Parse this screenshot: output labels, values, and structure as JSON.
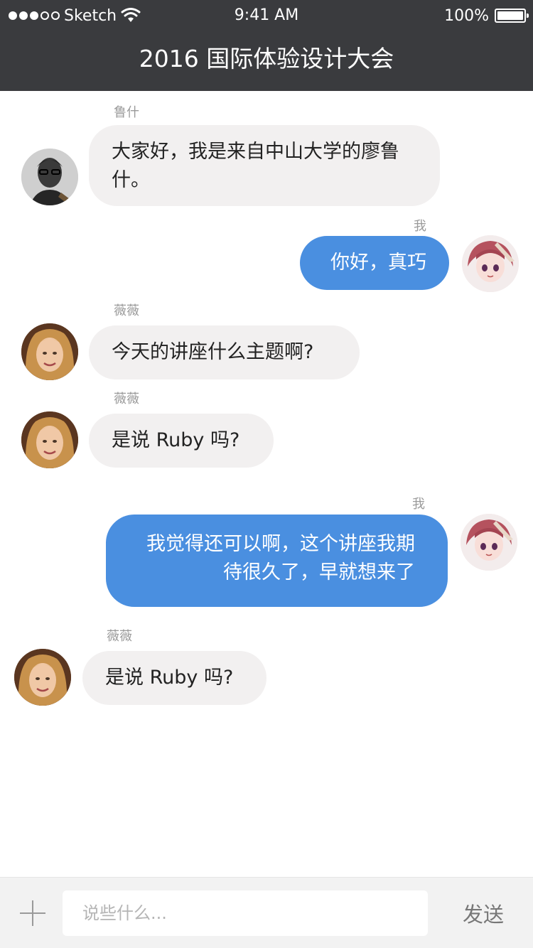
{
  "status_bar": {
    "carrier": "Sketch",
    "time": "9:41 AM",
    "battery": "100%"
  },
  "nav": {
    "title": "2016 国际体验设计大会"
  },
  "messages": [
    {
      "sender": "鲁什",
      "text": "大家好，我是来自中山大学的廖鲁什。",
      "direction": "incoming",
      "avatar": "avatar-man-icon"
    },
    {
      "sender": "我",
      "text": "你好，真巧",
      "direction": "outgoing",
      "avatar": "avatar-anime-girl-icon"
    },
    {
      "sender": "薇薇",
      "text": "今天的讲座什么主题啊?",
      "direction": "incoming",
      "avatar": "avatar-woman-icon"
    },
    {
      "sender": "薇薇",
      "text": "是说 Ruby 吗?",
      "direction": "incoming",
      "avatar": "avatar-woman-icon"
    },
    {
      "sender": "我",
      "text": "我觉得还可以啊，这个讲座我期待很久了，早就想来了",
      "direction": "outgoing",
      "avatar": "avatar-anime-girl-icon"
    },
    {
      "sender": "薇薇",
      "text": "是说 Ruby 吗?",
      "direction": "incoming",
      "avatar": "avatar-woman-icon"
    }
  ],
  "input": {
    "placeholder": "说些什么...",
    "send_label": "发送"
  },
  "colors": {
    "nav_bg": "#3a3b3e",
    "incoming_bubble": "#f2f0f0",
    "outgoing_bubble": "#4a8fe0",
    "input_bar_bg": "#f2f2f2"
  }
}
